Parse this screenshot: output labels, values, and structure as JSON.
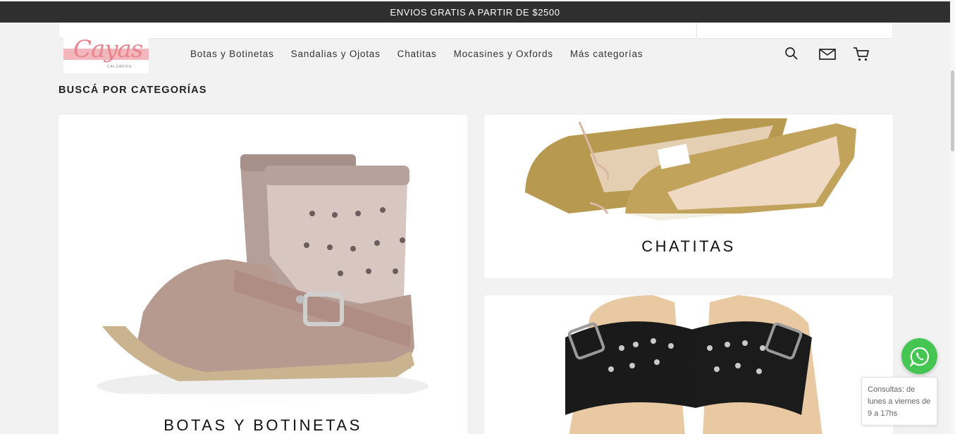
{
  "announcement": "ENVIOS GRATIS A PARTIR DE $2500",
  "logo": {
    "wordmark": "Cayas",
    "subtitle": "CALZADOS"
  },
  "nav": [
    "Botas y Botinetas",
    "Sandalias y Ojotas",
    "Chatitas",
    "Mocasines y Oxfords",
    "Más categorías"
  ],
  "icons": {
    "search": "search-icon",
    "contact": "envelope-icon",
    "cart": "cart-icon",
    "whatsapp": "whatsapp-icon"
  },
  "section_title": "BUSCÁ POR CATEGORÍAS",
  "categories": [
    {
      "label": "BOTAS Y BOTINETAS"
    },
    {
      "label": "CHATITAS"
    },
    {
      "label": ""
    }
  ],
  "whatsapp": {
    "tooltip": "Consultas: de lunes a viernes de 9 a 17hs"
  },
  "colors": {
    "topbar": "#2f2f2f",
    "whatsapp": "#45c653",
    "logo_pink": "#e9858f"
  }
}
